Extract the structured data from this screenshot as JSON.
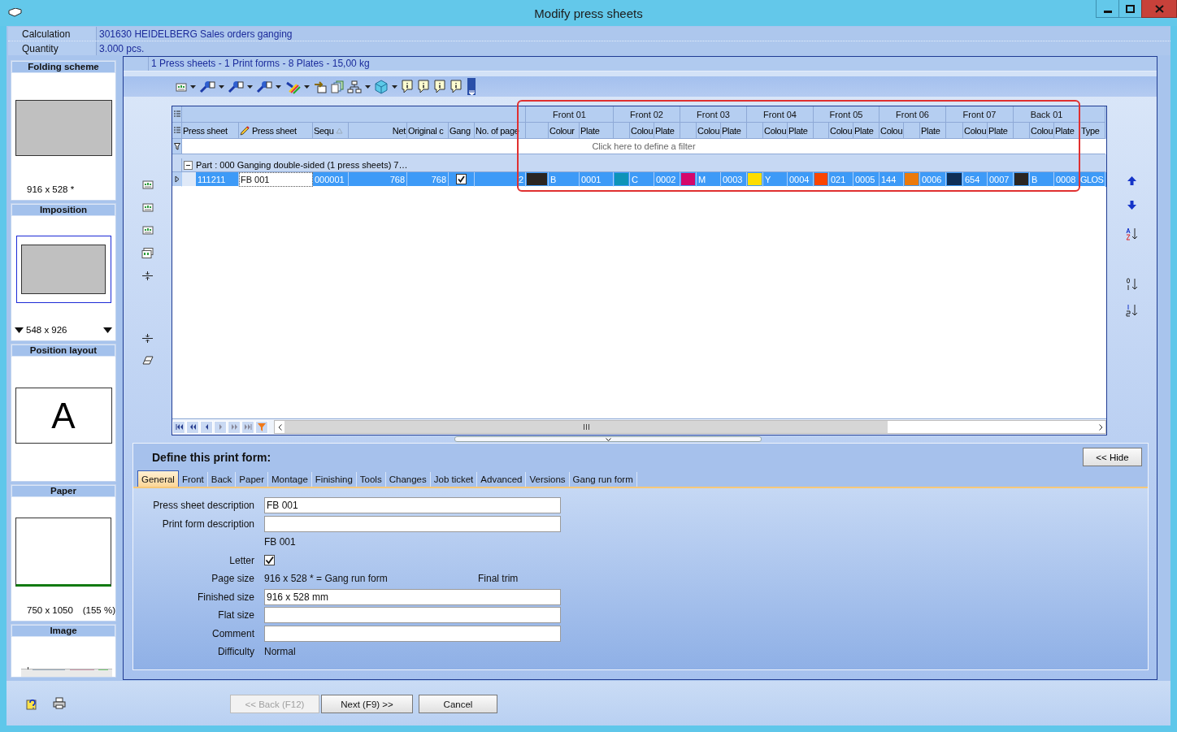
{
  "window": {
    "title": "Modify press sheets"
  },
  "info": [
    {
      "label": "Calculation",
      "value": "301630 HEIDELBERG Sales orders ganging"
    },
    {
      "label": "Quantity",
      "value": "3.000 pcs."
    }
  ],
  "previews": [
    {
      "kind": "sheet",
      "title": "Folding scheme",
      "caption": "916 x 528 *"
    },
    {
      "kind": "imposition",
      "title": "Imposition",
      "caption": "548 x 926"
    },
    {
      "kind": "letter",
      "title": "Position layout",
      "letter": "A"
    },
    {
      "kind": "paper",
      "title": "Paper",
      "caption": "750 x 1050",
      "zoom": "(155 %)"
    },
    {
      "title": "Image"
    }
  ],
  "summary": "1 Press sheets - 1 Print forms - 8 Plates - 15,00 kg",
  "grid": {
    "columns": [
      {
        "label": "Press sheet",
        "kind": "plain"
      },
      {
        "label": "Press sheet",
        "kind": "editable"
      },
      {
        "label": "Sequ",
        "kind": "sorted"
      },
      {
        "label": "Net",
        "kind": "numeric"
      },
      {
        "label": "Original c",
        "kind": "plain"
      },
      {
        "label": "Gang",
        "kind": "plain"
      },
      {
        "label": "No. of page",
        "kind": "plain"
      }
    ],
    "ink_groups": [
      {
        "title": "Front 01",
        "kind": "swatch-first",
        "colour_header": "Colour",
        "plate_header": "Plate"
      },
      {
        "title": "Front 02",
        "kind": "swatch-first",
        "colour_header": "Colou",
        "plate_header": "Plate"
      },
      {
        "title": "Front 03",
        "kind": "swatch-first",
        "colour_header": "Colou",
        "plate_header": "Plate"
      },
      {
        "title": "Front 04",
        "kind": "swatch-first",
        "colour_header": "Colou",
        "plate_header": "Plate"
      },
      {
        "title": "Front 05",
        "kind": "swatch-first",
        "colour_header": "Colou",
        "plate_header": "Plate"
      },
      {
        "title": "Front 06",
        "kind": "colour-first",
        "colour_header": "Colou",
        "plate_header": "Plate"
      },
      {
        "title": "Front 07",
        "kind": "swatch-first",
        "colour_header": "Colou",
        "plate_header": "Plate"
      },
      {
        "title": "Back 01",
        "kind": "swatch-first",
        "colour_header": "Colou",
        "plate_header": "Plate"
      }
    ],
    "type_header": "Type",
    "filter_placeholder": "Click here to define a filter",
    "group_row": {
      "text": "Part : 000 Ganging double-sided (1 press sheets) 7…",
      "expanded": true
    },
    "rows": [
      {
        "selected": true,
        "press_sheet": "111211",
        "description": "FB 001",
        "sequence": "000001",
        "net": "768",
        "original": "768",
        "gang": true,
        "pages": "2",
        "type": "GLOS",
        "inks": [
          {
            "color": "#2b2622",
            "colour": "B",
            "plate": "0001"
          },
          {
            "color": "#0e93b8",
            "colour": "C",
            "plate": "0002"
          },
          {
            "color": "#d4076b",
            "colour": "M",
            "plate": "0003"
          },
          {
            "color": "#fddd00",
            "colour": "Y",
            "plate": "0004"
          },
          {
            "color": "#fb4500",
            "colour": "021",
            "plate": "0005"
          },
          {
            "color": "#ec7a0a",
            "colour": "144",
            "plate": "0006"
          },
          {
            "color": "#0f2f57",
            "colour": "654",
            "plate": "0007"
          },
          {
            "color": "#2b2622",
            "colour": "B",
            "plate": "0008"
          }
        ]
      }
    ]
  },
  "form": {
    "title": "Define this print form:",
    "hide_button": "<< Hide",
    "tabs": [
      {
        "label": "General",
        "selected": true
      },
      {
        "label": "Front",
        "selected": false
      },
      {
        "label": "Back",
        "selected": false
      },
      {
        "label": "Paper",
        "selected": false
      },
      {
        "label": "Montage",
        "selected": false
      },
      {
        "label": "Finishing",
        "selected": false
      },
      {
        "label": "Tools",
        "selected": false
      },
      {
        "label": "Changes",
        "selected": false
      },
      {
        "label": "Job ticket",
        "selected": false
      },
      {
        "label": "Advanced",
        "selected": false
      },
      {
        "label": "Versions",
        "selected": false
      },
      {
        "label": "Gang run form",
        "selected": false
      }
    ],
    "fields": [
      {
        "kind": "input",
        "label": "Press sheet description",
        "value": "FB 001"
      },
      {
        "kind": "input",
        "label": "Print form description"
      },
      {
        "kind": "note",
        "value": "FB 001"
      },
      {
        "kind": "checkbox",
        "label": "Letter",
        "checked": true
      },
      {
        "kind": "text",
        "label": "Page size",
        "value": "916 x 528 * = Gang run form",
        "extra": "Final trim"
      },
      {
        "kind": "input",
        "label": "Finished size",
        "value": "916 x 528 mm"
      },
      {
        "kind": "input",
        "label": "Flat size"
      },
      {
        "kind": "input",
        "label": "Comment"
      },
      {
        "kind": "text",
        "label": "Difficulty",
        "value": "Normal"
      }
    ]
  },
  "footer": {
    "buttons": [
      {
        "label": "<< Back (F12)",
        "disabled": true
      },
      {
        "label": "Next (F9) >>",
        "disabled": false
      },
      {
        "label": "Cancel",
        "disabled": false
      }
    ]
  }
}
